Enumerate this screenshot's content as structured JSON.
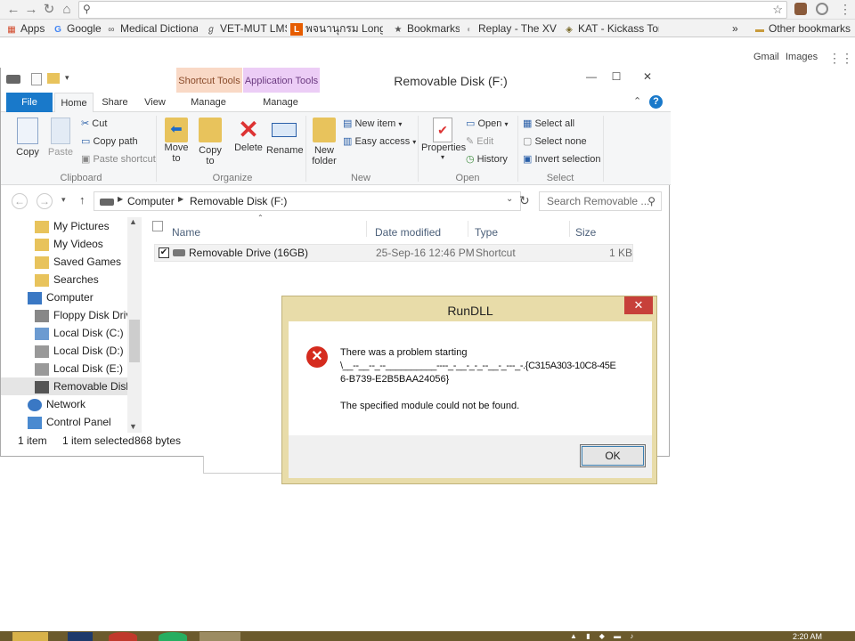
{
  "browser": {
    "bookmarks": [
      {
        "icon": "apps-icon",
        "label": "Apps"
      },
      {
        "icon": "google-icon",
        "label": "Google"
      },
      {
        "icon": "medical-icon",
        "label": "Medical Dictionar"
      },
      {
        "icon": "vet-icon",
        "label": "VET-MUT LMS"
      },
      {
        "icon": "longdo-icon",
        "label": "พจนานุกรม Longd"
      },
      {
        "icon": "star-icon",
        "label": "Bookmarks"
      },
      {
        "icon": "replay-icon",
        "label": "Replay - The XV I"
      },
      {
        "icon": "kat-icon",
        "label": "KAT - Kickass Tor"
      }
    ],
    "more_bookmarks": "»",
    "other_bookmarks": "Other bookmarks",
    "links": {
      "gmail": "Gmail",
      "images": "Images"
    }
  },
  "explorer": {
    "title": "Removable Disk (F:)",
    "contextual_tabs": {
      "shortcut_tools": "Shortcut Tools",
      "application_tools": "Application Tools"
    },
    "tabs": [
      "File",
      "Home",
      "Share",
      "View",
      "Manage",
      "Manage"
    ],
    "ribbon": {
      "clipboard": {
        "copy": "Copy",
        "paste": "Paste",
        "cut": "Cut",
        "copy_path": "Copy path",
        "paste_shortcut": "Paste shortcut",
        "group": "Clipboard"
      },
      "organize": {
        "move_to": "Move\nto",
        "copy_to": "Copy\nto",
        "delete": "Delete",
        "rename": "Rename",
        "group": "Organize"
      },
      "new": {
        "new_folder": "New\nfolder",
        "new_item": "New item",
        "easy_access": "Easy access",
        "group": "New"
      },
      "open": {
        "properties": "Properties",
        "open": "Open",
        "edit": "Edit",
        "history": "History",
        "group": "Open"
      },
      "select": {
        "select_all": "Select all",
        "select_none": "Select none",
        "invert": "Invert selection",
        "group": "Select"
      }
    },
    "address": {
      "crumbs": [
        "Computer",
        "Removable Disk (F:)"
      ],
      "search_placeholder": "Search Removable ..."
    },
    "nav_items": [
      {
        "label": "My Pictures",
        "icon": "pictures-icon"
      },
      {
        "label": "My Videos",
        "icon": "videos-icon"
      },
      {
        "label": "Saved Games",
        "icon": "games-icon"
      },
      {
        "label": "Searches",
        "icon": "searches-icon"
      },
      {
        "label": "Computer",
        "icon": "computer-icon"
      },
      {
        "label": "Floppy Disk Drive",
        "icon": "floppy-icon"
      },
      {
        "label": "Local Disk (C:)",
        "icon": "drive-icon"
      },
      {
        "label": "Local Disk (D:)",
        "icon": "drive-icon"
      },
      {
        "label": "Local Disk (E:)",
        "icon": "drive-icon"
      },
      {
        "label": "Removable Disk",
        "icon": "usb-icon"
      },
      {
        "label": "Network",
        "icon": "network-icon"
      },
      {
        "label": "Control Panel",
        "icon": "control-panel-icon"
      }
    ],
    "columns": [
      "Name",
      "Date modified",
      "Type",
      "Size"
    ],
    "files": [
      {
        "name": "Removable Drive (16GB)",
        "date": "25-Sep-16 12:46 PM",
        "type": "Shortcut",
        "size": "1 KB"
      }
    ],
    "status": {
      "items": "1 item",
      "selected": "1 item selected",
      "bytes": "868 bytes"
    }
  },
  "dialog": {
    "title": "RunDLL",
    "close": "✕",
    "line1": "There was a problem starting",
    "line2": "\\__--__--_--__________----_-__-_-_--__-_---_-.{C315A303-10C8-45E",
    "line3": "6-B739-E2B5BAA24056}",
    "line4": "The specified module could not be found.",
    "ok": "OK"
  },
  "taskbar": {
    "time": "2:20 AM"
  }
}
